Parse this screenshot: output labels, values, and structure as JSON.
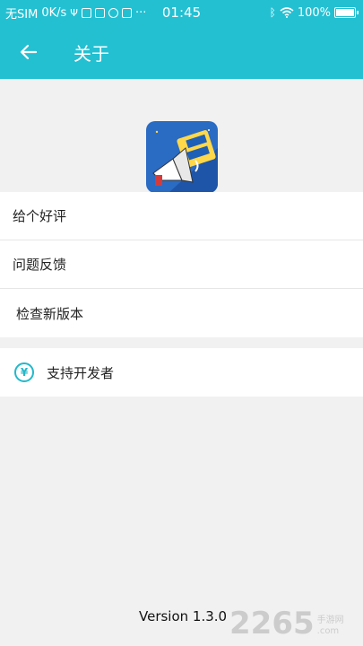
{
  "status_bar": {
    "carrier": "无SIM",
    "speed": "0K/s",
    "time": "01:45",
    "battery": "100%"
  },
  "header": {
    "title": "关于"
  },
  "menu": {
    "items": [
      {
        "label": "给个好评"
      },
      {
        "label": "问题反馈"
      },
      {
        "label": "检查新版本"
      }
    ],
    "support_label": "支持开发者",
    "support_icon_glyph": "¥"
  },
  "footer": {
    "version": "Version 1.3.0"
  },
  "watermark": {
    "number": "2265",
    "site_top": "手游网",
    "site_bottom": ".com"
  },
  "colors": {
    "accent": "#23c0d2",
    "icon_teal": "#23b8c9"
  }
}
